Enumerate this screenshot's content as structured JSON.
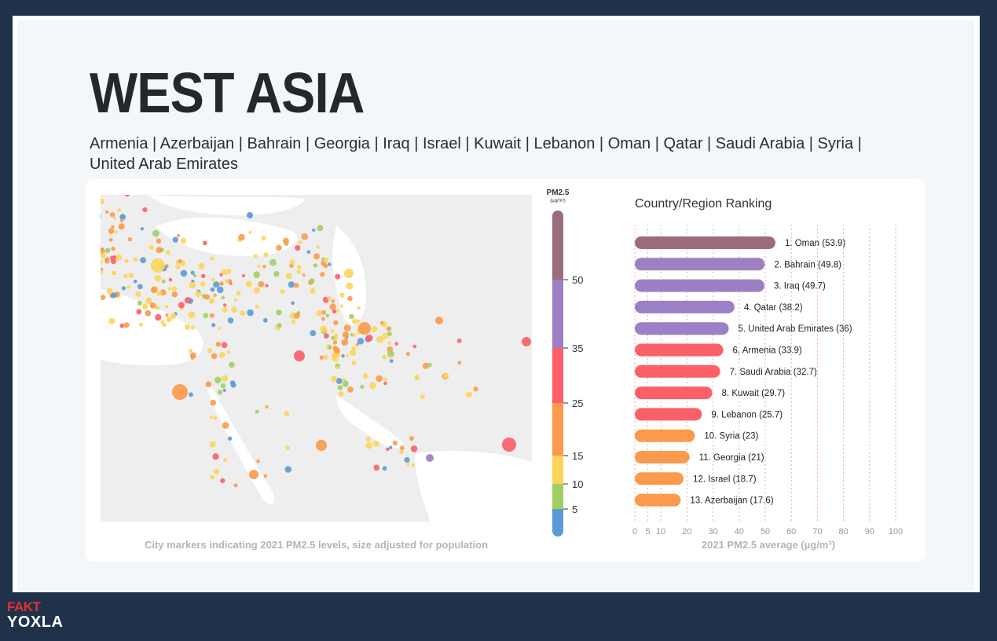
{
  "header": {
    "title": "WEST ASIA",
    "countries": "Armenia | Azerbaijan | Bahrain | Georgia | Iraq | Israel | Kuwait | Lebanon | Oman | Qatar | Saudi Arabia | Syria | United Arab Emirates"
  },
  "map": {
    "caption": "City markers indicating 2021 PM2.5 levels, size adjusted for population"
  },
  "legend": {
    "title": "PM2.5",
    "unit": "(µg/m³)",
    "ticks": [
      "50",
      "35",
      "25",
      "15",
      "10",
      "5"
    ],
    "bands": [
      {
        "from": 0,
        "to": 5,
        "color": "#5b9bd5"
      },
      {
        "from": 5,
        "to": 10,
        "color": "#a0cf63"
      },
      {
        "from": 10,
        "to": 15,
        "color": "#fbd55b"
      },
      {
        "from": 15,
        "to": 25,
        "color": "#fb9a4d"
      },
      {
        "from": 25,
        "to": 35,
        "color": "#fb6068"
      },
      {
        "from": 35,
        "to": 50,
        "color": "#9c7fc4"
      },
      {
        "from": 50,
        "to": 100,
        "color": "#9b6c7c"
      }
    ]
  },
  "chart_data": {
    "type": "bar",
    "title": "Country/Region Ranking",
    "xlabel": "2021 PM2.5 average (µg/m³)",
    "xlim": [
      0,
      100
    ],
    "xticks": [
      "0",
      "5",
      "10",
      "20",
      "30",
      "40",
      "50",
      "60",
      "70",
      "80",
      "90",
      "100"
    ],
    "categories": [
      "Oman",
      "Bahrain",
      "Iraq",
      "Qatar",
      "United Arab Emirates",
      "Armenia",
      "Saudi Arabia",
      "Kuwait",
      "Lebanon",
      "Syria",
      "Georgia",
      "Israel",
      "Azerbaijan"
    ],
    "labels": [
      "1. Oman (53.9)",
      "2. Bahrain (49.8)",
      "3. Iraq (49.7)",
      "4. Qatar (38.2)",
      "5. United Arab Emirates (36)",
      "6. Armenia (33.9)",
      "7. Saudi Arabia (32.7)",
      "8. Kuwait (29.7)",
      "9. Lebanon (25.7)",
      "10. Syria (23)",
      "11. Georgia (21)",
      "12. Israel (18.7)",
      "13. Azerbaijan (17.6)"
    ],
    "values": [
      53.9,
      49.8,
      49.7,
      38.2,
      36,
      33.9,
      32.7,
      29.7,
      25.7,
      23,
      21,
      18.7,
      17.6
    ],
    "colors": [
      "#9b6c7c",
      "#9c7fc4",
      "#9c7fc4",
      "#9c7fc4",
      "#9c7fc4",
      "#fb6068",
      "#fb6068",
      "#fb6068",
      "#fb6068",
      "#fb9a4d",
      "#fb9a4d",
      "#fb9a4d",
      "#fb9a4d"
    ],
    "grid": true
  },
  "branding": {
    "logo_top": "FAKT",
    "logo_bottom": "YOXLA"
  }
}
